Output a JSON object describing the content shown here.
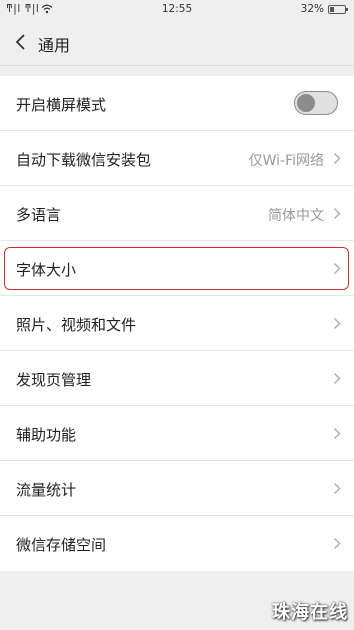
{
  "status_bar": {
    "left_text": "ͳ|l ͳ|l",
    "time": "12:55",
    "battery_text": "32%",
    "battery_level": 0.32
  },
  "nav": {
    "back_icon": "chevron-left-icon",
    "title": "通用"
  },
  "settings": [
    {
      "label": "开启横屏模式",
      "type": "toggle",
      "on": false
    },
    {
      "label": "自动下载微信安装包",
      "value": "仅Wi-Fi网络",
      "type": "link"
    },
    {
      "label": "多语言",
      "value": "简体中文",
      "type": "link"
    },
    {
      "label": "字体大小",
      "type": "link",
      "highlighted": true,
      "highlight_color": "#d32f2f"
    },
    {
      "label": "照片、视频和文件",
      "type": "link"
    },
    {
      "label": "发现页管理",
      "type": "link"
    },
    {
      "label": "辅助功能",
      "type": "link"
    },
    {
      "label": "流量统计",
      "type": "link"
    },
    {
      "label": "微信存储空间",
      "type": "link"
    }
  ],
  "watermark": "珠海在线"
}
